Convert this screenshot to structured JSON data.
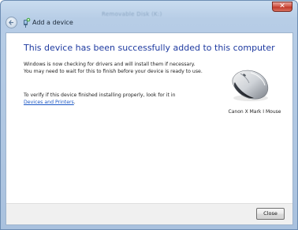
{
  "window": {
    "title": "Add a device",
    "background_text": "Removable Disk (K:)",
    "close_glyph": "✕"
  },
  "main": {
    "heading": "This device has been successfully added to this computer",
    "paragraph1": "Windows is now checking for drivers and will install them if necessary. You may need to wait for this to finish before your device is ready to use.",
    "paragraph2_prefix": "To verify if this device finished installing properly, look for it in",
    "devices_link": "Devices and Printers",
    "paragraph2_suffix": ".",
    "device": {
      "name": "Canon X Mark I Mouse",
      "icon": "mouse-icon"
    }
  },
  "footer": {
    "close_label": "Close"
  },
  "colors": {
    "heading": "#1e3aa0",
    "link": "#1a56c4",
    "close_red": "#c0392b"
  }
}
